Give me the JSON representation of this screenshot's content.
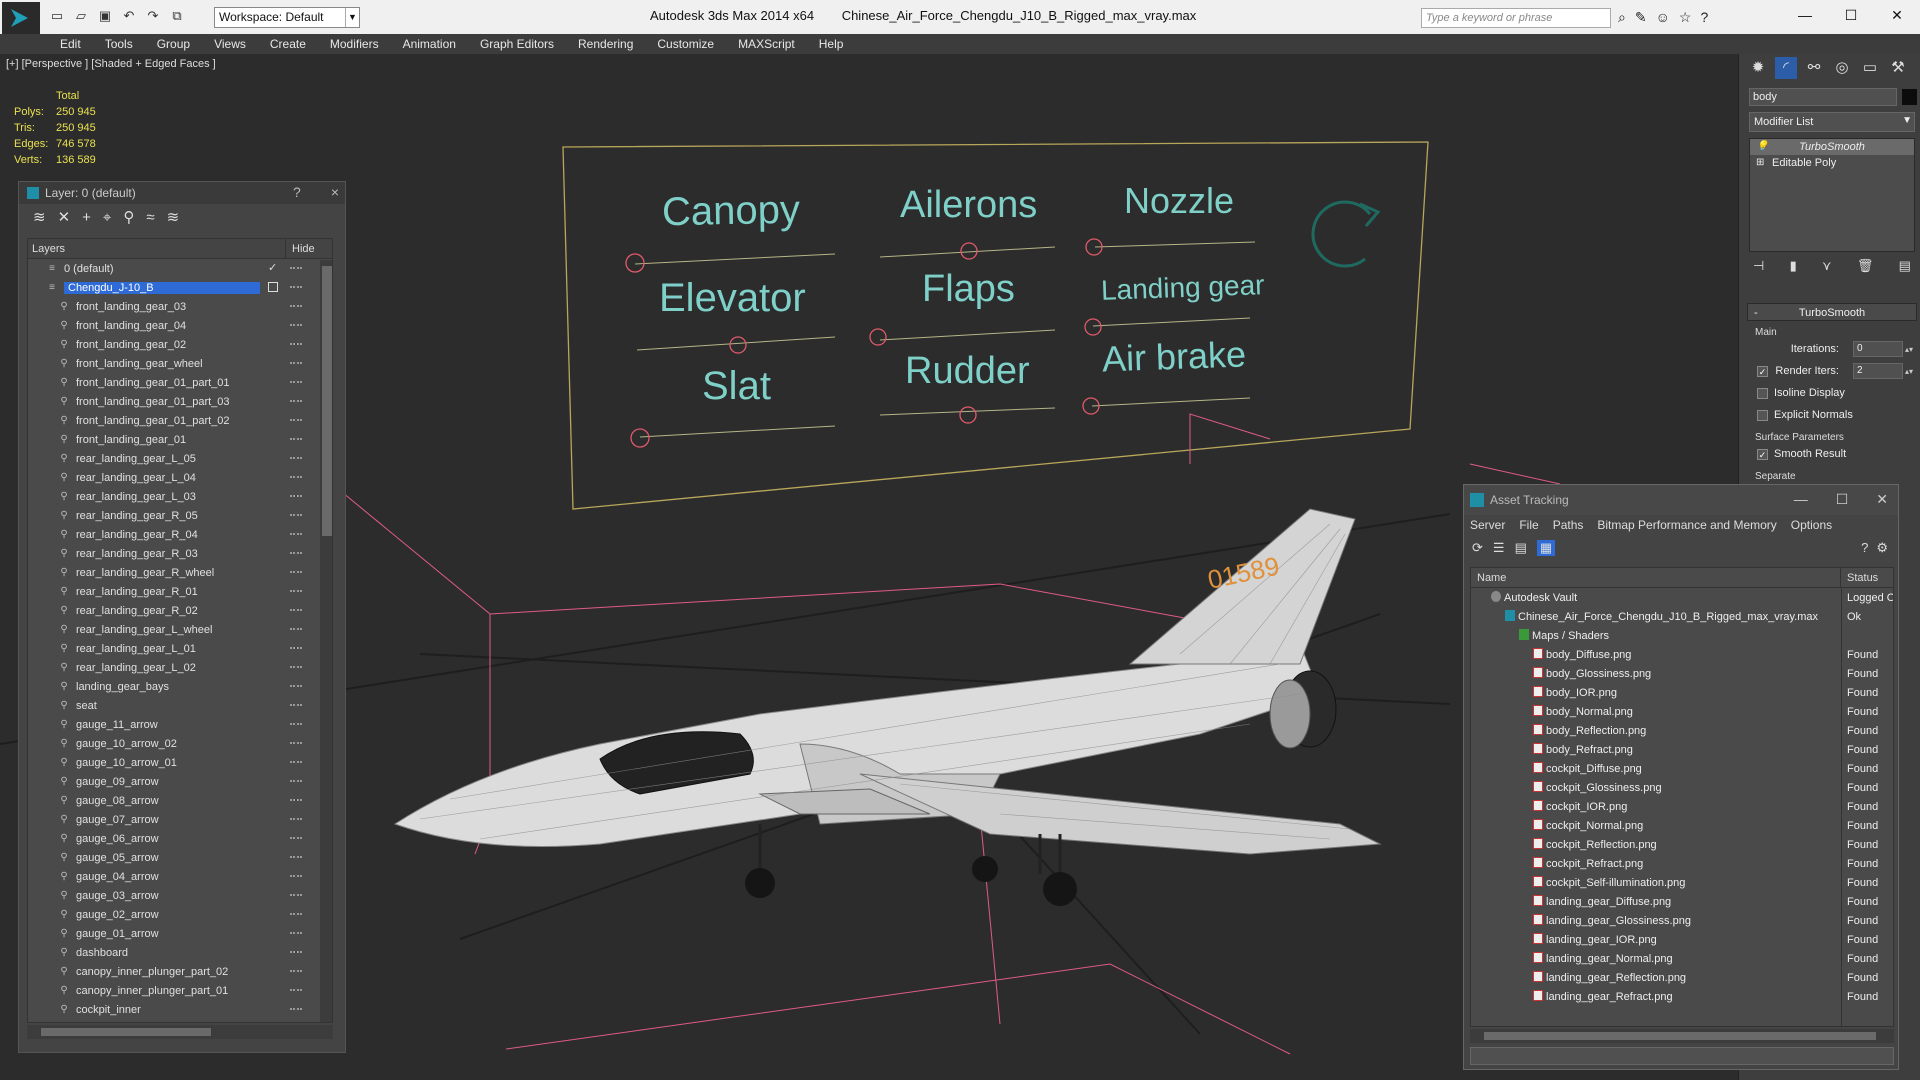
{
  "titlebar": {
    "app": "Autodesk 3ds Max  2014 x64",
    "file": "Chinese_Air_Force_Chengdu_J10_B_Rigged_max_vray.max",
    "workspace": "Workspace: Default",
    "search_placeholder": "Type a keyword or phrase"
  },
  "menu": [
    "Edit",
    "Tools",
    "Group",
    "Views",
    "Create",
    "Modifiers",
    "Animation",
    "Graph Editors",
    "Rendering",
    "Customize",
    "MAXScript",
    "Help"
  ],
  "viewport": {
    "label": "[+] [Perspective ] [Shaded + Edged Faces ]",
    "stats": {
      "total_label": "Total",
      "rows": [
        {
          "k": "Polys:",
          "v": "250 945"
        },
        {
          "k": "Tris:",
          "v": "250 945"
        },
        {
          "k": "Edges:",
          "v": "746 578"
        },
        {
          "k": "Verts:",
          "v": "136 589"
        }
      ]
    },
    "board_labels": [
      "Canopy",
      "Ailerons",
      "Nozzle",
      "Elevator",
      "Flaps",
      "Landing gear",
      "Slat",
      "Rudder",
      "Air brake"
    ],
    "tail_number": "01589"
  },
  "layer_panel": {
    "title": "Layer: 0 (default)",
    "help": "?",
    "close": "×",
    "col_layers": "Layers",
    "col_hide": "Hide",
    "rows": [
      {
        "name": "0 (default)",
        "kind": "layer",
        "check": "✓"
      },
      {
        "name": "Chengdu_J-10_B",
        "kind": "layer",
        "selected": true
      },
      {
        "name": "front_landing_gear_03"
      },
      {
        "name": "front_landing_gear_04"
      },
      {
        "name": "front_landing_gear_02"
      },
      {
        "name": "front_landing_gear_wheel"
      },
      {
        "name": "front_landing_gear_01_part_01"
      },
      {
        "name": "front_landing_gear_01_part_03"
      },
      {
        "name": "front_landing_gear_01_part_02"
      },
      {
        "name": "front_landing_gear_01"
      },
      {
        "name": "rear_landing_gear_L_05"
      },
      {
        "name": "rear_landing_gear_L_04"
      },
      {
        "name": "rear_landing_gear_L_03"
      },
      {
        "name": "rear_landing_gear_R_05"
      },
      {
        "name": "rear_landing_gear_R_04"
      },
      {
        "name": "rear_landing_gear_R_03"
      },
      {
        "name": "rear_landing_gear_R_wheel"
      },
      {
        "name": "rear_landing_gear_R_01"
      },
      {
        "name": "rear_landing_gear_R_02"
      },
      {
        "name": "rear_landing_gear_L_wheel"
      },
      {
        "name": "rear_landing_gear_L_01"
      },
      {
        "name": "rear_landing_gear_L_02"
      },
      {
        "name": "landing_gear_bays"
      },
      {
        "name": "seat"
      },
      {
        "name": "gauge_11_arrow"
      },
      {
        "name": "gauge_10_arrow_02"
      },
      {
        "name": "gauge_10_arrow_01"
      },
      {
        "name": "gauge_09_arrow"
      },
      {
        "name": "gauge_08_arrow"
      },
      {
        "name": "gauge_07_arrow"
      },
      {
        "name": "gauge_06_arrow"
      },
      {
        "name": "gauge_05_arrow"
      },
      {
        "name": "gauge_04_arrow"
      },
      {
        "name": "gauge_03_arrow"
      },
      {
        "name": "gauge_02_arrow"
      },
      {
        "name": "gauge_01_arrow"
      },
      {
        "name": "dashboard"
      },
      {
        "name": "canopy_inner_plunger_part_02"
      },
      {
        "name": "canopy_inner_plunger_part_01"
      },
      {
        "name": "cockpit_inner"
      }
    ]
  },
  "command_panel": {
    "object_name": "body",
    "modifier_list": "Modifier List",
    "stack": [
      "TurboSmooth",
      "Editable Poly"
    ],
    "rollout_title": "TurboSmooth",
    "main_label": "Main",
    "iterations_label": "Iterations:",
    "iterations_value": "0",
    "render_iters_label": "Render Iters:",
    "render_iters_value": "2",
    "isoline": "Isoline Display",
    "explicit": "Explicit Normals",
    "surface_label": "Surface Parameters",
    "smooth_result": "Smooth Result",
    "separate": "Separate"
  },
  "asset_tracking": {
    "title": "Asset Tracking",
    "menu": [
      "Server",
      "File",
      "Paths",
      "Bitmap Performance and Memory",
      "Options"
    ],
    "col_name": "Name",
    "col_status": "Status",
    "rows": [
      {
        "name": "Autodesk Vault",
        "status": "Logged O",
        "indent": 1,
        "icon": "vault"
      },
      {
        "name": "Chinese_Air_Force_Chengdu_J10_B_Rigged_max_vray.max",
        "status": "Ok",
        "indent": 2,
        "icon": "max"
      },
      {
        "name": "Maps / Shaders",
        "status": "",
        "indent": 3,
        "icon": "folder"
      },
      {
        "name": "body_Diffuse.png",
        "status": "Found",
        "indent": 4,
        "icon": "png"
      },
      {
        "name": "body_Glossiness.png",
        "status": "Found",
        "indent": 4,
        "icon": "png"
      },
      {
        "name": "body_IOR.png",
        "status": "Found",
        "indent": 4,
        "icon": "png"
      },
      {
        "name": "body_Normal.png",
        "status": "Found",
        "indent": 4,
        "icon": "png"
      },
      {
        "name": "body_Reflection.png",
        "status": "Found",
        "indent": 4,
        "icon": "png"
      },
      {
        "name": "body_Refract.png",
        "status": "Found",
        "indent": 4,
        "icon": "png"
      },
      {
        "name": "cockpit_Diffuse.png",
        "status": "Found",
        "indent": 4,
        "icon": "png"
      },
      {
        "name": "cockpit_Glossiness.png",
        "status": "Found",
        "indent": 4,
        "icon": "png"
      },
      {
        "name": "cockpit_IOR.png",
        "status": "Found",
        "indent": 4,
        "icon": "png"
      },
      {
        "name": "cockpit_Normal.png",
        "status": "Found",
        "indent": 4,
        "icon": "png"
      },
      {
        "name": "cockpit_Reflection.png",
        "status": "Found",
        "indent": 4,
        "icon": "png"
      },
      {
        "name": "cockpit_Refract.png",
        "status": "Found",
        "indent": 4,
        "icon": "png"
      },
      {
        "name": "cockpit_Self-illumination.png",
        "status": "Found",
        "indent": 4,
        "icon": "png"
      },
      {
        "name": "landing_gear_Diffuse.png",
        "status": "Found",
        "indent": 4,
        "icon": "png"
      },
      {
        "name": "landing_gear_Glossiness.png",
        "status": "Found",
        "indent": 4,
        "icon": "png"
      },
      {
        "name": "landing_gear_IOR.png",
        "status": "Found",
        "indent": 4,
        "icon": "png"
      },
      {
        "name": "landing_gear_Normal.png",
        "status": "Found",
        "indent": 4,
        "icon": "png"
      },
      {
        "name": "landing_gear_Reflection.png",
        "status": "Found",
        "indent": 4,
        "icon": "png"
      },
      {
        "name": "landing_gear_Refract.png",
        "status": "Found",
        "indent": 4,
        "icon": "png"
      }
    ]
  },
  "colors": {
    "accent": "#2e6bd6",
    "stats": "#e8e050",
    "board_text": "#7fd0c8",
    "helper": "#e05a8a",
    "board_frame": "#b8a65a"
  }
}
